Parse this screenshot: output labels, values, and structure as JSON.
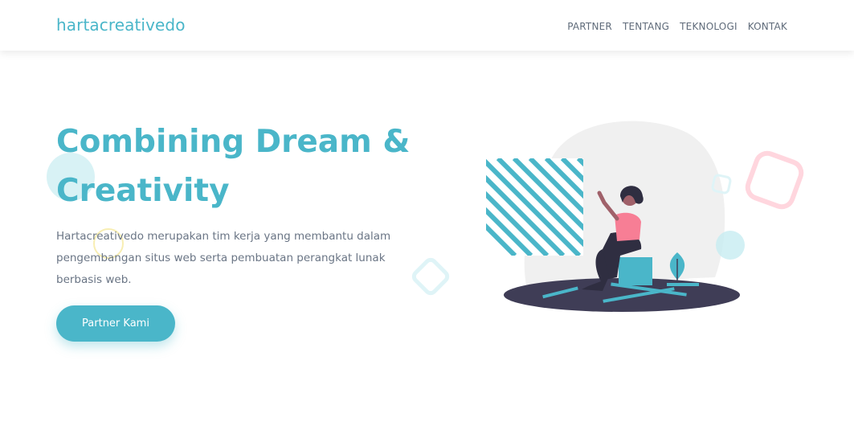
{
  "navbar": {
    "brand": "hartacreativedo",
    "links": [
      "PARTNER",
      "TENTANG",
      "TEKNOLOGI",
      "KONTAK"
    ]
  },
  "hero": {
    "title_line1": "Combining Dream &",
    "title_line2": "Creativity",
    "description": "Hartacreativedo merupakan tim kerja yang membantu dalam pengembangan situs web serta pembuatan perangkat lunak berbasis web.",
    "cta_label": "Partner Kami"
  },
  "colors": {
    "accent": "#4ab6c9",
    "text_muted": "#6a7585",
    "dark_floor": "#3f3d56",
    "pink": "#f77e95"
  },
  "icons": [
    "woman-working-illustration"
  ]
}
